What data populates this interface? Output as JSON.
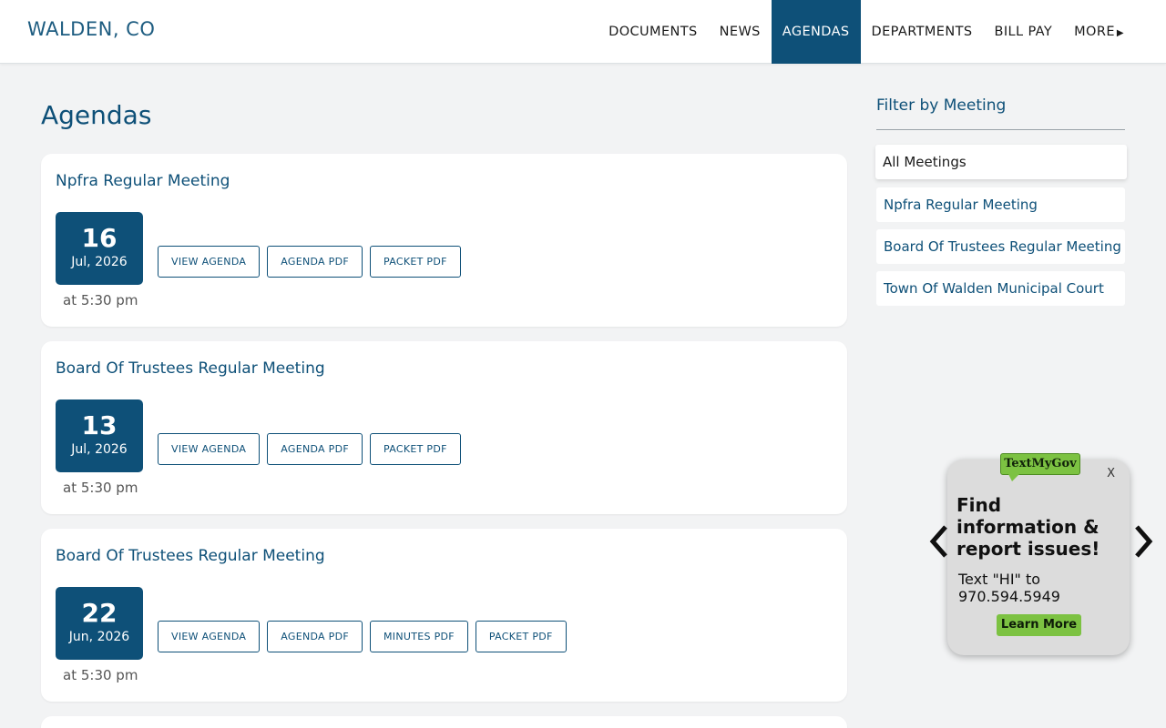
{
  "header": {
    "site_title": "WALDEN, CO",
    "nav": [
      {
        "label": "DOCUMENTS"
      },
      {
        "label": "NEWS"
      },
      {
        "label": "AGENDAS",
        "active": true
      },
      {
        "label": "DEPARTMENTS"
      },
      {
        "label": "BILL PAY"
      },
      {
        "label": "MORE"
      }
    ]
  },
  "main": {
    "page_title": "Agendas",
    "meetings": [
      {
        "title": "Npfra Regular Meeting",
        "day": "16",
        "month_year": "Jul, 2026",
        "time": "at 5:30 pm",
        "buttons": [
          "VIEW AGENDA",
          "AGENDA PDF",
          "PACKET PDF"
        ]
      },
      {
        "title": "Board Of Trustees Regular Meeting",
        "day": "13",
        "month_year": "Jul, 2026",
        "time": "at 5:30 pm",
        "buttons": [
          "VIEW AGENDA",
          "AGENDA PDF",
          "PACKET PDF"
        ]
      },
      {
        "title": "Board Of Trustees Regular Meeting",
        "day": "22",
        "month_year": "Jun, 2026",
        "time": "at 5:30 pm",
        "buttons": [
          "VIEW AGENDA",
          "AGENDA PDF",
          "MINUTES PDF",
          "PACKET PDF"
        ]
      }
    ]
  },
  "sidebar": {
    "filter_title": "Filter by Meeting",
    "items": [
      {
        "label": "All Meetings",
        "selected": true
      },
      {
        "label": "Npfra Regular Meeting"
      },
      {
        "label": "Board Of Trustees Regular Meeting"
      },
      {
        "label": "Town Of Walden Municipal Court"
      }
    ]
  },
  "widget": {
    "logo": "TextMyGov",
    "close": "X",
    "headline": "Find information & report issues!",
    "text": "Text \"HI\" to 970.594.5949",
    "learn_more": "Learn More"
  },
  "colors": {
    "brand": "#0e5078",
    "widget_green": "#7cc242",
    "background": "#f2f3f4"
  }
}
